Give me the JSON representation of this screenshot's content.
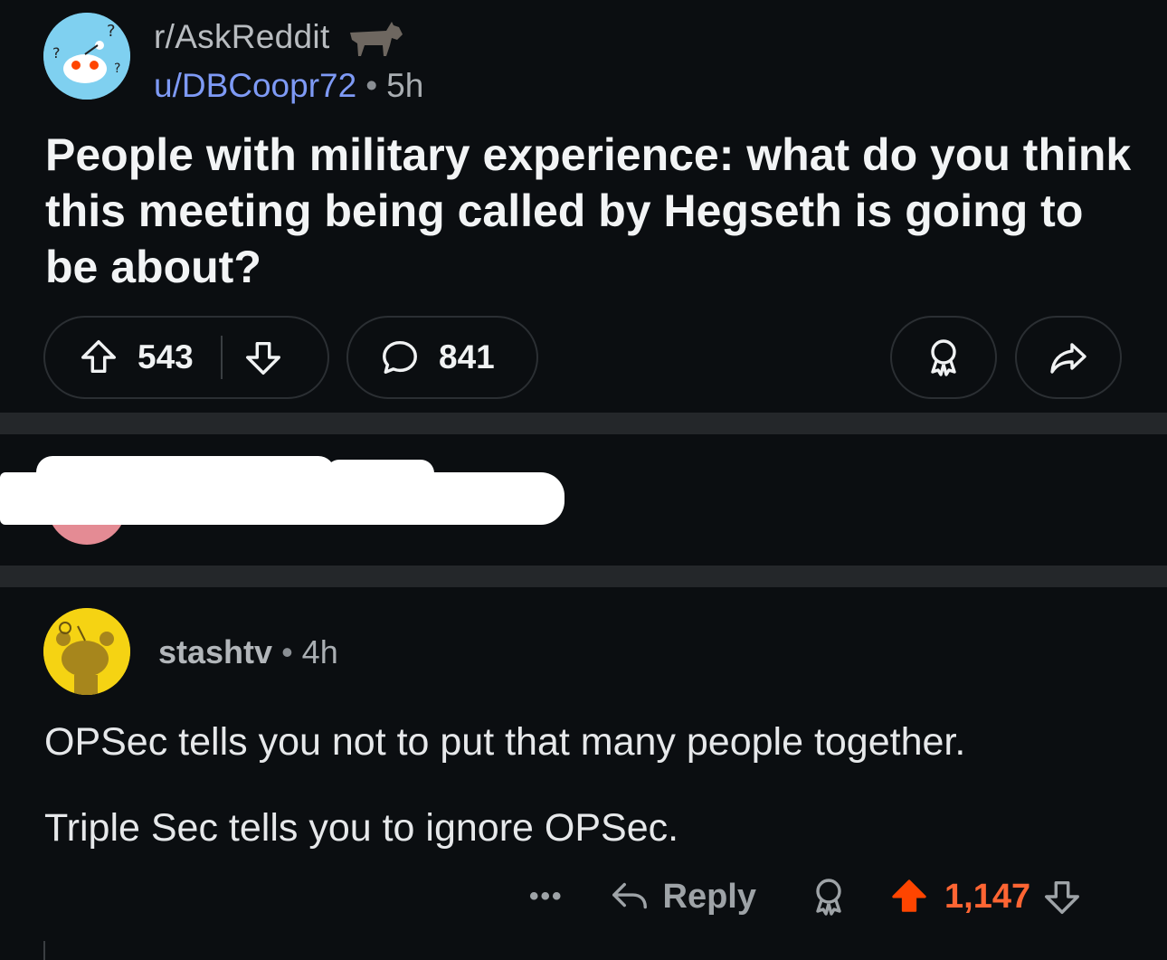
{
  "post": {
    "subreddit": "r/AskReddit",
    "author": "u/DBCoopr72",
    "separator": "•",
    "age": "5h",
    "title": "People with military experience: what do you think this meeting being called by Hegseth is going to be about?",
    "upvotes": "543",
    "comments": "841",
    "icons": [
      "upvote-icon",
      "downvote-icon",
      "comment-icon",
      "award-icon",
      "share-icon"
    ]
  },
  "comment": {
    "author": "stashtv",
    "separator": "•",
    "age": "4h",
    "lines": [
      "OPSec tells you not to put that many people together.",
      "Triple Sec tells you to ignore OPSec."
    ],
    "more_label": "•••",
    "reply_label": "Reply",
    "score": "1,147"
  },
  "colors": {
    "background": "#0b0e11",
    "divider_band": "#24272a",
    "author_link": "#7e9af5",
    "upvoted": "#ff4500",
    "score": "#ff6533",
    "comment_avatar": "#f5d313",
    "subreddit_avatar": "#7fd0f0"
  }
}
